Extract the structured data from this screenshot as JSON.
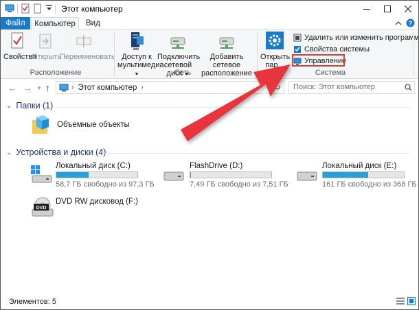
{
  "window": {
    "title": "Этот компьютер"
  },
  "tabs": {
    "file": "Файл",
    "computer": "Компьютер",
    "view": "Вид"
  },
  "ribbon": {
    "location": {
      "properties": "Свойства",
      "open": "Открыть",
      "rename": "Переименовать",
      "group_label": "Расположение"
    },
    "network": {
      "media_access_1": "Доступ к",
      "media_access_2": "мультимедиа",
      "map_drive_1": "Подключить",
      "map_drive_2": "сетевой диск",
      "add_location_1": "Добавить сетевое",
      "add_location_2": "расположение",
      "group_label": "Сеть"
    },
    "system": {
      "open_settings_1": "Открыть",
      "open_settings_2": "пар...",
      "uninstall": "Удалить или изменить программу",
      "system_properties": "Свойства системы",
      "manage": "Управление",
      "group_label": "Система"
    }
  },
  "navigation": {
    "address_path": "Этот компьютер",
    "search_placeholder": "Поиск: Этот компьютер"
  },
  "content": {
    "folders_header": "Папки (1)",
    "folders": [
      {
        "name": "Объемные объекты"
      }
    ],
    "devices_header": "Устройства и диски (4)",
    "drives": [
      {
        "name": "Локальный диск (C:)",
        "free_text": "58,7 ГБ свободно из 97,3 ГБ",
        "used_fraction": 0.4
      },
      {
        "name": "FlashDrive (D:)",
        "free_text": "7,49 ГБ свободно из 7,51 ГБ",
        "used_fraction": 0.003
      },
      {
        "name": "Локальный диск (E:)",
        "free_text": "161 ГБ свободно из 368 ГБ",
        "used_fraction": 0.56
      },
      {
        "name": "DVD RW дисковод (F:)"
      }
    ]
  },
  "status": {
    "items_count": "Элементов: 5"
  },
  "colors": {
    "accent": "#1979ca",
    "drive_bar": "#26a0da",
    "highlight": "#e53935",
    "arrow": "#e8343c"
  }
}
